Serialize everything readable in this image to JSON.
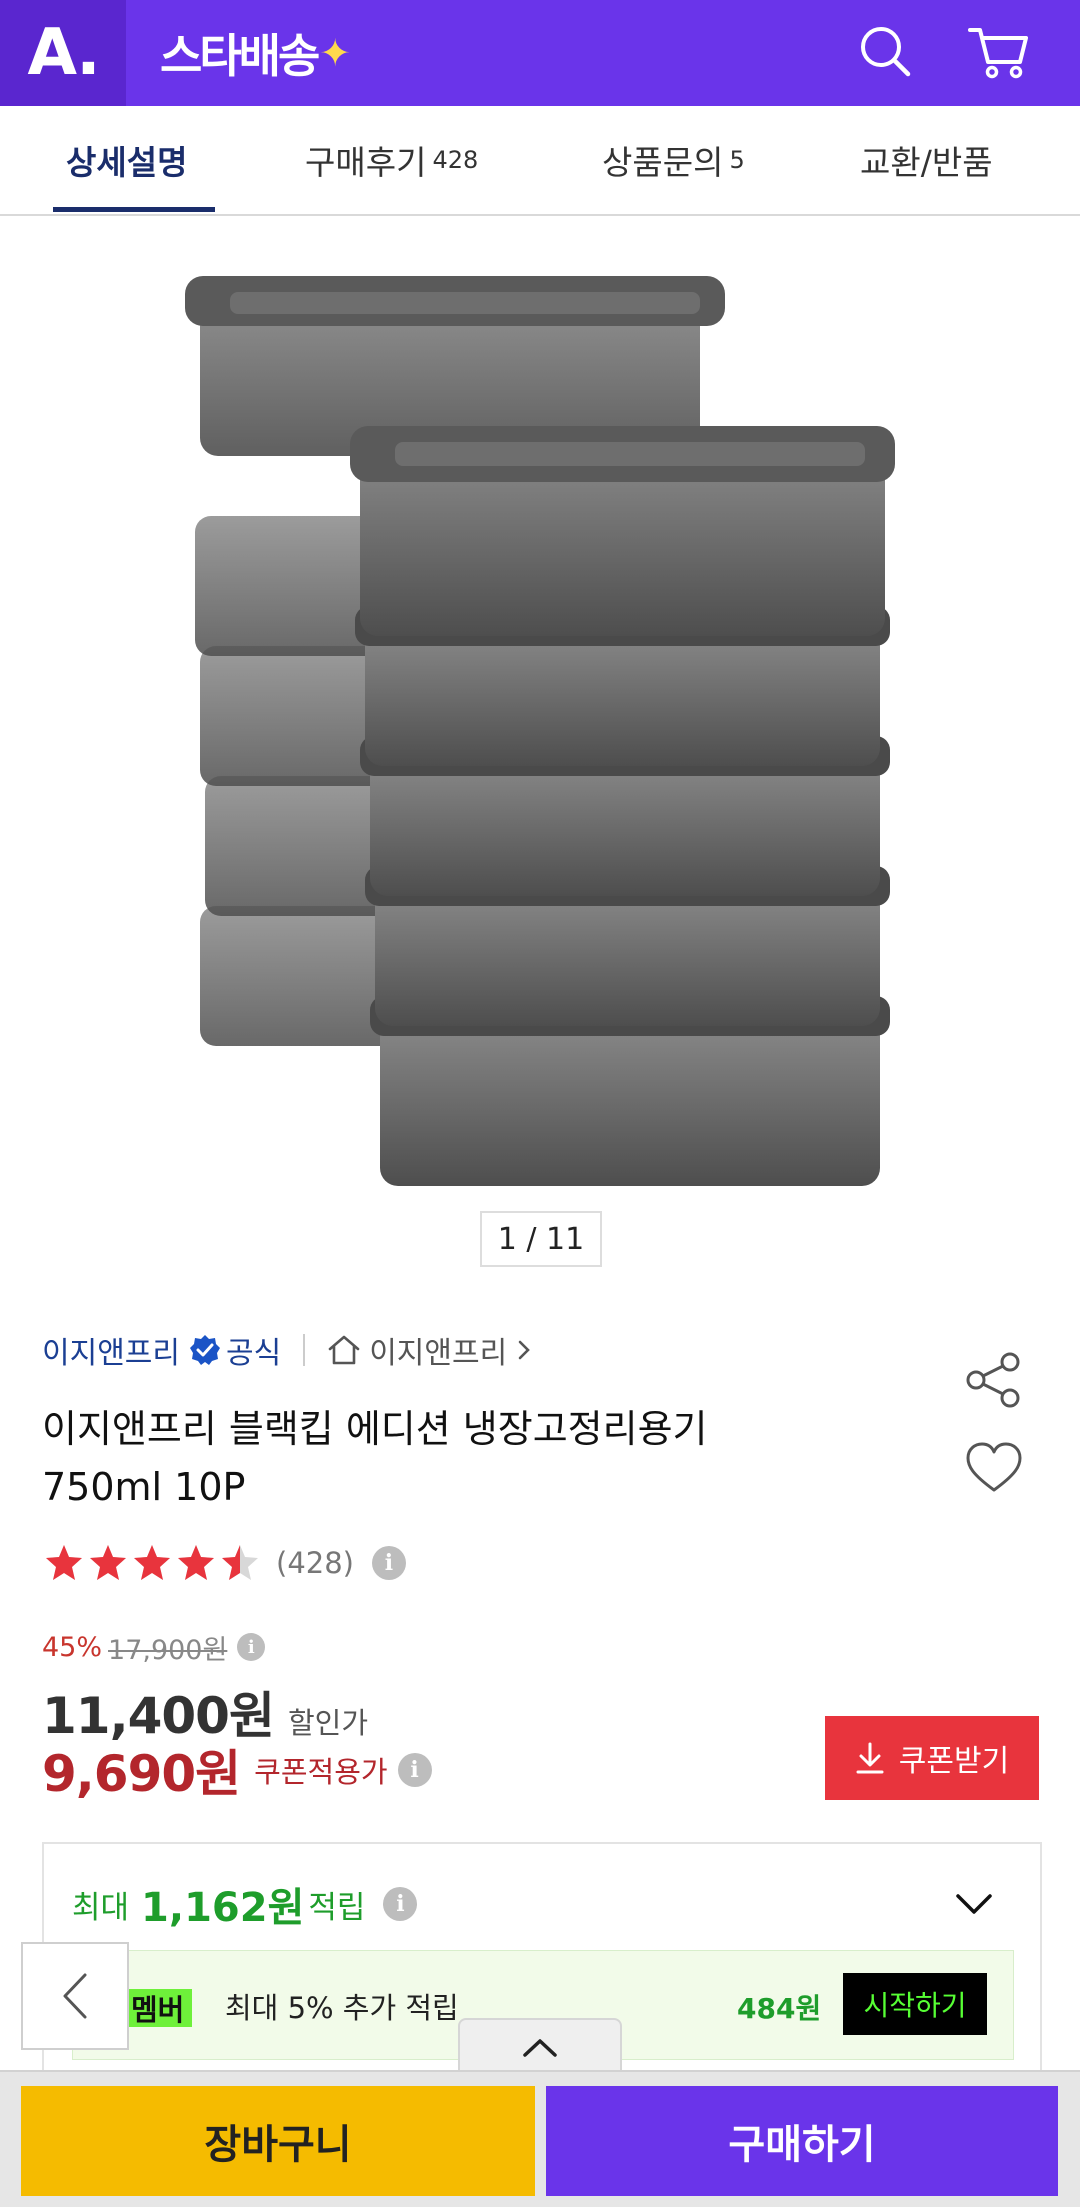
{
  "header": {
    "logo_text": "A.",
    "brand_text": "스타배송",
    "brand_color": "#6a34ea"
  },
  "tabs": [
    {
      "label": "상세설명",
      "count": ""
    },
    {
      "label": "구매후기",
      "count": "428"
    },
    {
      "label": "상품문의",
      "count": "5"
    },
    {
      "label": "교환/반품",
      "count": ""
    }
  ],
  "gallery": {
    "pager": "1 / 11",
    "image_subject": "stacked black food storage containers"
  },
  "seller": {
    "name": "이지앤프리",
    "official": "공식",
    "store_link": "이지앤프리"
  },
  "product": {
    "title_line1": "이지앤프리 블랙킵 에디션 냉장고정리용기",
    "title_line2": "750ml 10P",
    "rating": 4.5,
    "rating_count": "(428)"
  },
  "price": {
    "discount_rate": "45%",
    "original_price": "17,900원",
    "sale_price": "11,400원",
    "sale_label": "할인가",
    "coupon_price": "9,690원",
    "coupon_label": "쿠폰적용가",
    "coupon_button": "쿠폰받기"
  },
  "points": {
    "prefix": "최대",
    "amount": "1,162원",
    "suffix": "적립",
    "member_badge": "멤버",
    "member_text": "최대 5% 추가 적립",
    "member_amount": "484원",
    "member_button": "시작하기"
  },
  "bottom": {
    "cart_label": "장바구니",
    "buy_label": "구매하기"
  },
  "colors": {
    "accent": "#6a34ea",
    "coupon": "#e8343d",
    "price_red": "#b3262c",
    "points_green": "#1e9d2b",
    "cart_yellow": "#f5bb00"
  }
}
